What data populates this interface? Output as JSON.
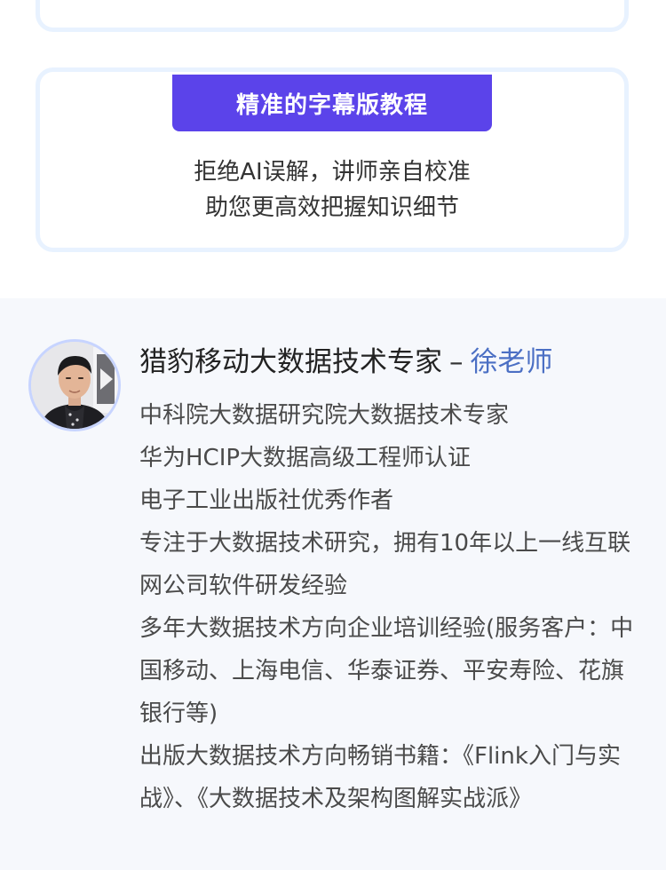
{
  "feature": {
    "badge": "精准的字幕版教程",
    "line1": "拒绝AI误解，讲师亲自校准",
    "line2": "助您更高效把握知识细节"
  },
  "teacher": {
    "title": "猎豹移动大数据技术专家",
    "separator": "–",
    "name": "徐老师",
    "bio": [
      "中科院大数据研究院大数据技术专家",
      "华为HCIP大数据高级工程师认证",
      "电子工业出版社优秀作者",
      "专注于大数据技术研究，拥有10年以上一线互联网公司软件研发经验",
      "多年大数据技术方向企业培训经验(服务客户：中国移动、上海电信、华泰证券、平安寿险、花旗银行等)",
      "出版大数据技术方向畅销书籍：《Flink入门与实战》、《大数据技术及架构图解实战派》"
    ]
  },
  "colors": {
    "accent": "#5b43ea",
    "name_link": "#4b6fc4",
    "card_border": "#e8f2ff",
    "section_bg": "#f6f8fc"
  }
}
